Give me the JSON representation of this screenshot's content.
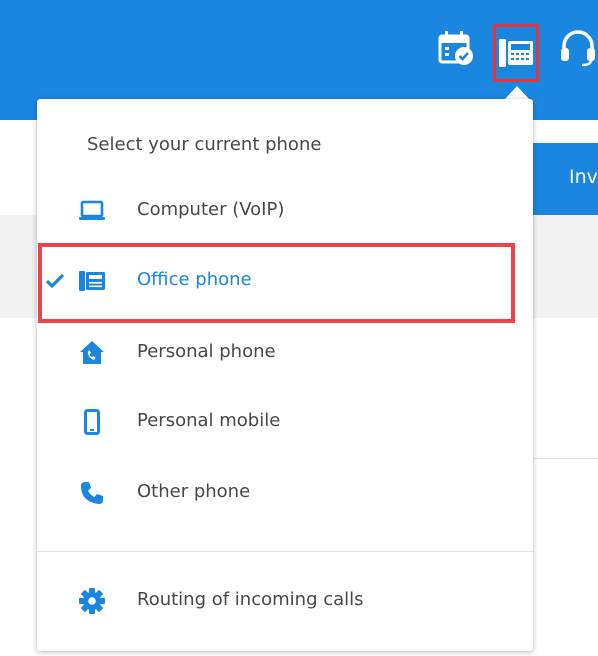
{
  "page": {
    "strip_text": "Inv"
  },
  "topbar": {
    "icons": [
      "calendar-check-icon",
      "desk-phone-icon",
      "headset-icon"
    ]
  },
  "menu": {
    "header": "Select your current phone",
    "items": [
      {
        "label": "Computer (VoIP)",
        "icon": "laptop-icon",
        "selected": false
      },
      {
        "label": "Office phone",
        "icon": "desk-phone-icon",
        "selected": true
      },
      {
        "label": "Personal phone",
        "icon": "home-phone-icon",
        "selected": false
      },
      {
        "label": "Personal mobile",
        "icon": "mobile-icon",
        "selected": false
      },
      {
        "label": "Other phone",
        "icon": "phone-handset-icon",
        "selected": false
      }
    ],
    "footer_item": {
      "label": "Routing of incoming calls",
      "icon": "gear-icon"
    }
  },
  "colors": {
    "brand": "#1a86e0",
    "highlight": "#e8444b",
    "text": "#474747"
  }
}
